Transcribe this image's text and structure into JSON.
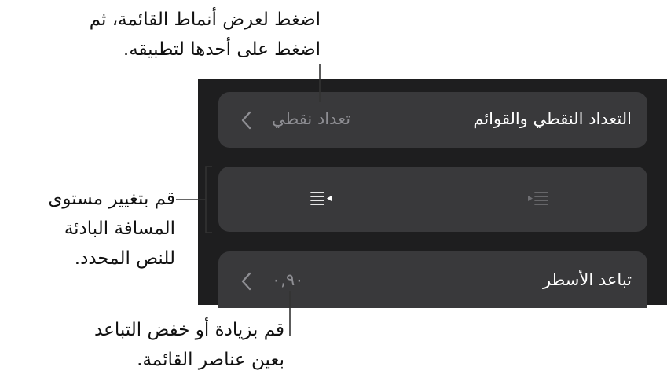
{
  "callouts": {
    "list_styles": "اضغط لعرض أنماط القائمة، ثم\nاضغط على أحدها لتطبيقه.",
    "indent": "قم بتغيير مستوى\nالمسافة البادئة\nللنص المحدد.",
    "spacing": "قم بزيادة أو خفض التباعد\nبعين عناصر القائمة."
  },
  "panel": {
    "bullets_row": {
      "label": "التعداد النقطي والقوائم",
      "value": "تعداد نقطي",
      "chevron_icon": "chevron-left-icon"
    },
    "indent_row": {
      "decrease_icon": "outdent-icon",
      "increase_icon": "indent-icon"
    },
    "spacing_row": {
      "label": "تباعد الأسطر",
      "value": "٠,٩٠",
      "chevron_icon": "chevron-left-icon"
    }
  },
  "colors": {
    "panel_bg": "#1e1e1f",
    "row_bg": "#39393b",
    "primary_text": "#ffffff",
    "secondary_text": "#8e8e93"
  }
}
